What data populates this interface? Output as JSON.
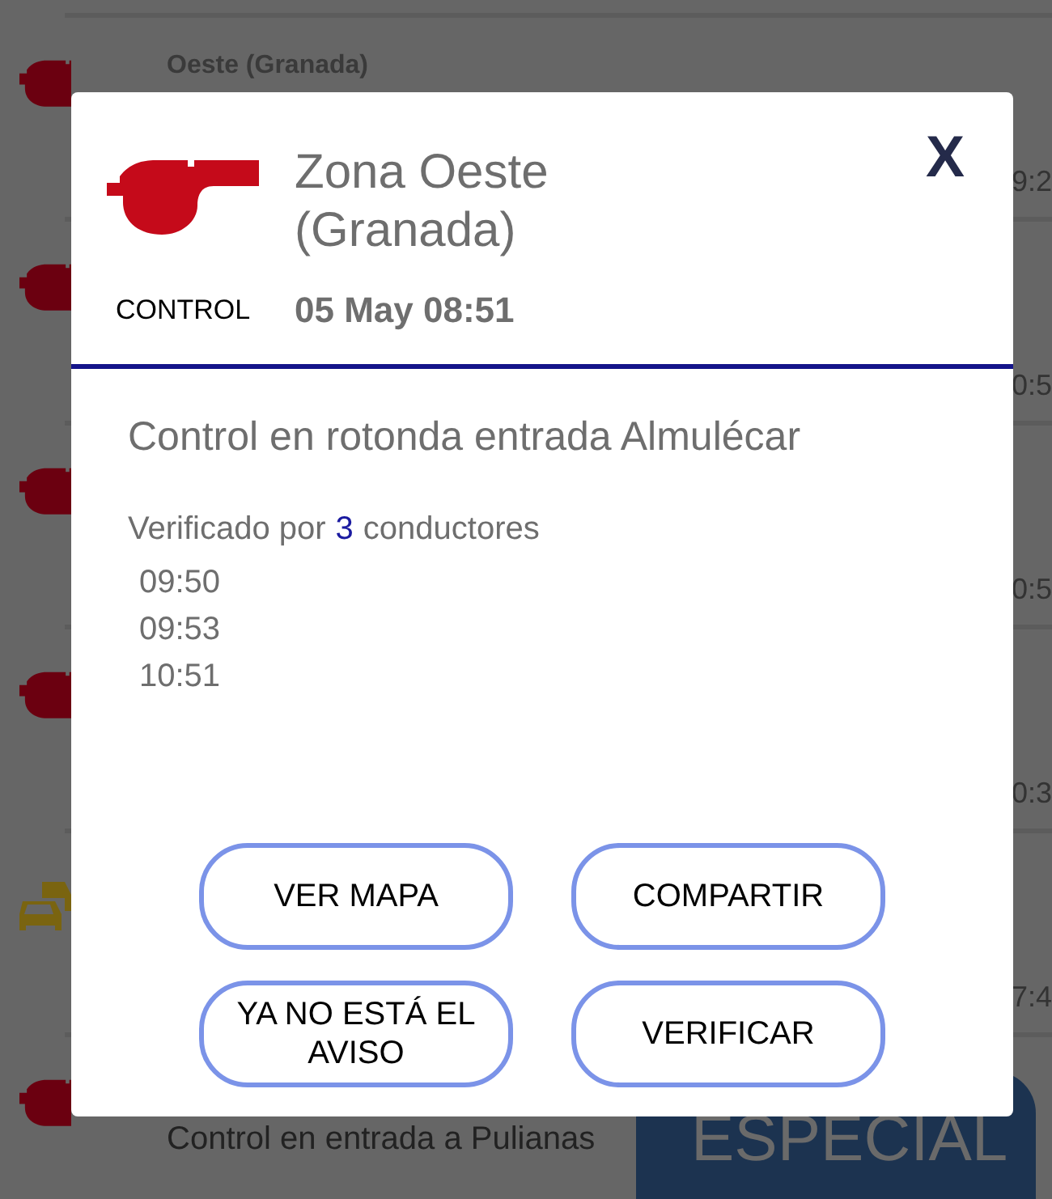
{
  "list": [
    {
      "kind": "control",
      "title": "Oeste (Granada)",
      "time": "9:2"
    },
    {
      "kind": "control",
      "time": "0:5"
    },
    {
      "kind": "control",
      "time": "0:5"
    },
    {
      "kind": "control",
      "time": "0:3"
    },
    {
      "kind": "traffic",
      "time": "7:4"
    },
    {
      "kind": "control",
      "title": "Control en entrada a Pulianas"
    }
  ],
  "banner": {
    "text": "ESPECIAL"
  },
  "dialog": {
    "category": "CONTROL",
    "title": "Zona Oeste (Granada)",
    "date": "05 May 08:51",
    "close": "X",
    "description": "Control en rotonda entrada Almulécar",
    "verified_prefix": "Verificado por",
    "verified_count": "3",
    "verified_suffix": "conductores",
    "verifications": [
      "09:50",
      "09:53",
      "10:51"
    ],
    "buttons": [
      "VER MAPA",
      "COMPARTIR",
      "YA NO ESTÁ EL AVISO",
      "VERIFICAR"
    ]
  }
}
